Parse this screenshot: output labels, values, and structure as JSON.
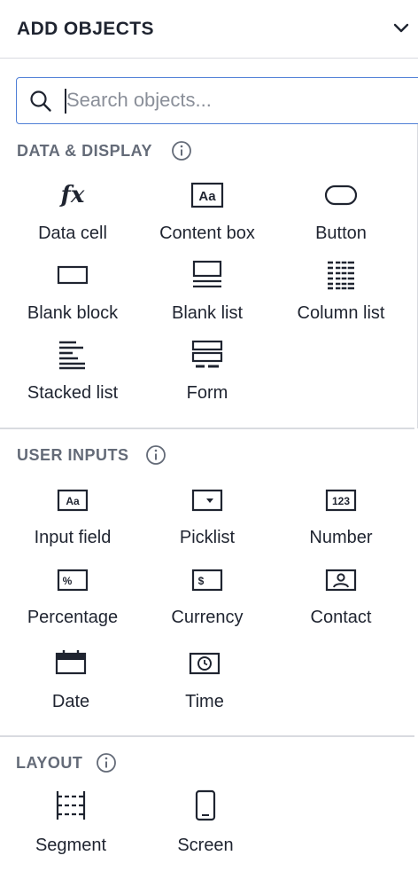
{
  "header": {
    "title": "ADD OBJECTS",
    "collapse_icon": "chevron-down-icon"
  },
  "search": {
    "placeholder": "Search objects...",
    "value": ""
  },
  "sections": {
    "data_display": {
      "title": "DATA & DISPLAY",
      "items": [
        {
          "label": "Data cell",
          "icon": "fx-icon",
          "glyph": "fx"
        },
        {
          "label": "Content box",
          "icon": "content-box-icon"
        },
        {
          "label": "Button",
          "icon": "button-icon"
        },
        {
          "label": "Blank block",
          "icon": "blank-block-icon"
        },
        {
          "label": "Blank list",
          "icon": "blank-list-icon"
        },
        {
          "label": "Column list",
          "icon": "column-list-icon"
        },
        {
          "label": "Stacked list",
          "icon": "stacked-list-icon"
        },
        {
          "label": "Form",
          "icon": "form-icon"
        }
      ]
    },
    "user_inputs": {
      "title": "USER INPUTS",
      "items": [
        {
          "label": "Input field",
          "icon": "input-field-icon",
          "glyph": "Aa"
        },
        {
          "label": "Picklist",
          "icon": "picklist-icon"
        },
        {
          "label": "Number",
          "icon": "number-icon",
          "glyph": "123"
        },
        {
          "label": "Percentage",
          "icon": "percentage-icon",
          "glyph": "%"
        },
        {
          "label": "Currency",
          "icon": "currency-icon",
          "glyph": "$"
        },
        {
          "label": "Contact",
          "icon": "contact-icon"
        },
        {
          "label": "Date",
          "icon": "calendar-icon"
        },
        {
          "label": "Time",
          "icon": "clock-icon"
        }
      ]
    },
    "layout": {
      "title": "LAYOUT",
      "items": [
        {
          "label": "Segment",
          "icon": "segment-icon"
        },
        {
          "label": "Screen",
          "icon": "phone-screen-icon"
        }
      ]
    }
  },
  "content_box_glyph": "Aa",
  "colors": {
    "text": "#1f2430",
    "section_title": "#646b78",
    "divider": "#d9dbe0",
    "focus_border": "#4f7fd6"
  }
}
